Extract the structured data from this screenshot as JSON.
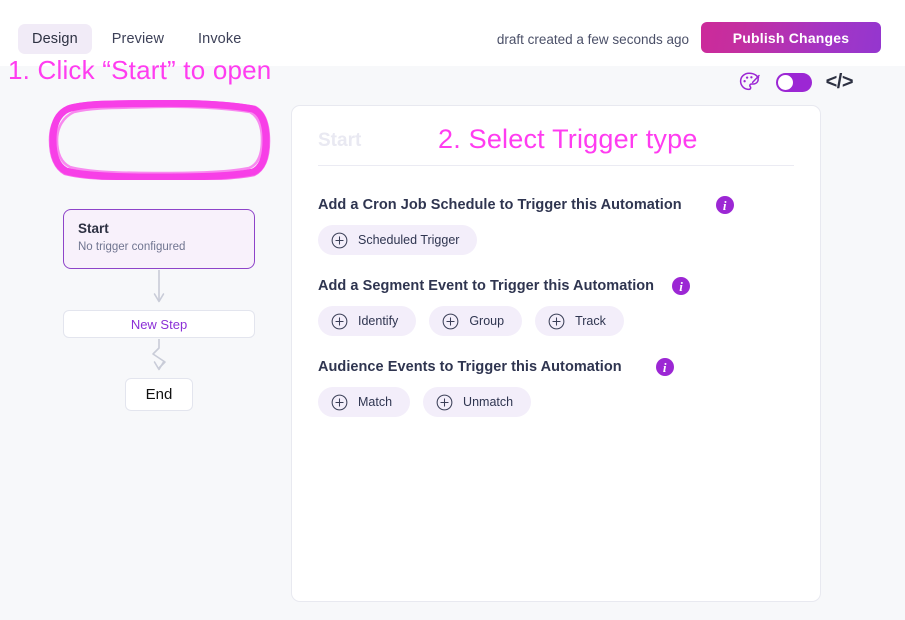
{
  "header": {
    "tabs": [
      {
        "label": "Design",
        "active": true
      },
      {
        "label": "Preview",
        "active": false
      },
      {
        "label": "Invoke",
        "active": false
      }
    ],
    "draft_status": "draft created a few seconds ago",
    "publish_label": "Publish Changes"
  },
  "toolbar": {
    "palette_icon": "palette-icon",
    "toggle_on": true,
    "code_icon": "</>"
  },
  "annotations": {
    "step1": "1. Click “Start” to open",
    "step2": "2. Select Trigger type",
    "color": "#ff3cf0"
  },
  "flow": {
    "start": {
      "title": "Start",
      "subtitle": "No trigger configured"
    },
    "new_step": "New Step",
    "end": "End"
  },
  "panel": {
    "breadcrumb": "Start",
    "groups": [
      {
        "title": "Add a Cron Job Schedule to Trigger this Automation",
        "info": "i",
        "chips": [
          {
            "label": "Scheduled Trigger"
          }
        ]
      },
      {
        "title": "Add a Segment Event to Trigger this Automation",
        "info": "i",
        "chips": [
          {
            "label": "Identify"
          },
          {
            "label": "Group"
          },
          {
            "label": "Track"
          }
        ]
      },
      {
        "title": "Audience Events to Trigger this Automation",
        "info": "i",
        "chips": [
          {
            "label": "Match"
          },
          {
            "label": "Unmatch"
          }
        ]
      }
    ]
  },
  "colors": {
    "accent_purple": "#9c27d4",
    "accent_magenta": "#ff3cf0",
    "page_bg": "#f7f8fa",
    "chip_bg": "#f3eefa"
  }
}
